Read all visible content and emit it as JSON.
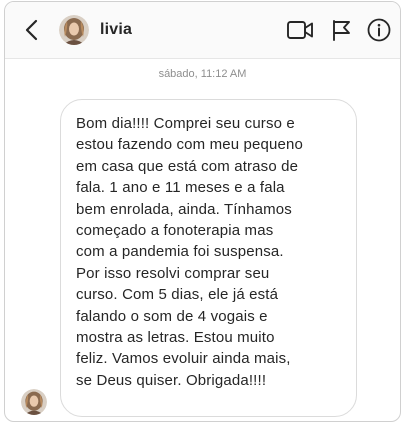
{
  "header": {
    "back_icon": "chevron-left-icon",
    "username": "livia",
    "actions": [
      "video-call-icon",
      "flag-icon",
      "info-icon"
    ]
  },
  "thread": {
    "timestamp": "sábado, 11:12 AM",
    "message": {
      "text": "Bom dia!!!! Comprei seu curso e\nestou fazendo com meu pequeno\nem casa que está com atraso de\nfala. 1 ano e 11 meses e a fala\nbem enrolada, ainda. Tínhamos\ncomeçado a fonoterapia mas\ncom a pandemia foi suspensa.\nPor isso resolvi comprar seu\ncurso. Com 5 dias, ele já está\nfalando o som de 4 vogais e\nmostra as letras. Estou muito\nfeliz. Vamos evoluir ainda mais,\nse Deus quiser. Obrigada!!!!"
    }
  },
  "colors": {
    "text": "#262626",
    "muted": "#8e8e8e",
    "border": "#dbdbdb",
    "header_bg": "#fafafa"
  }
}
